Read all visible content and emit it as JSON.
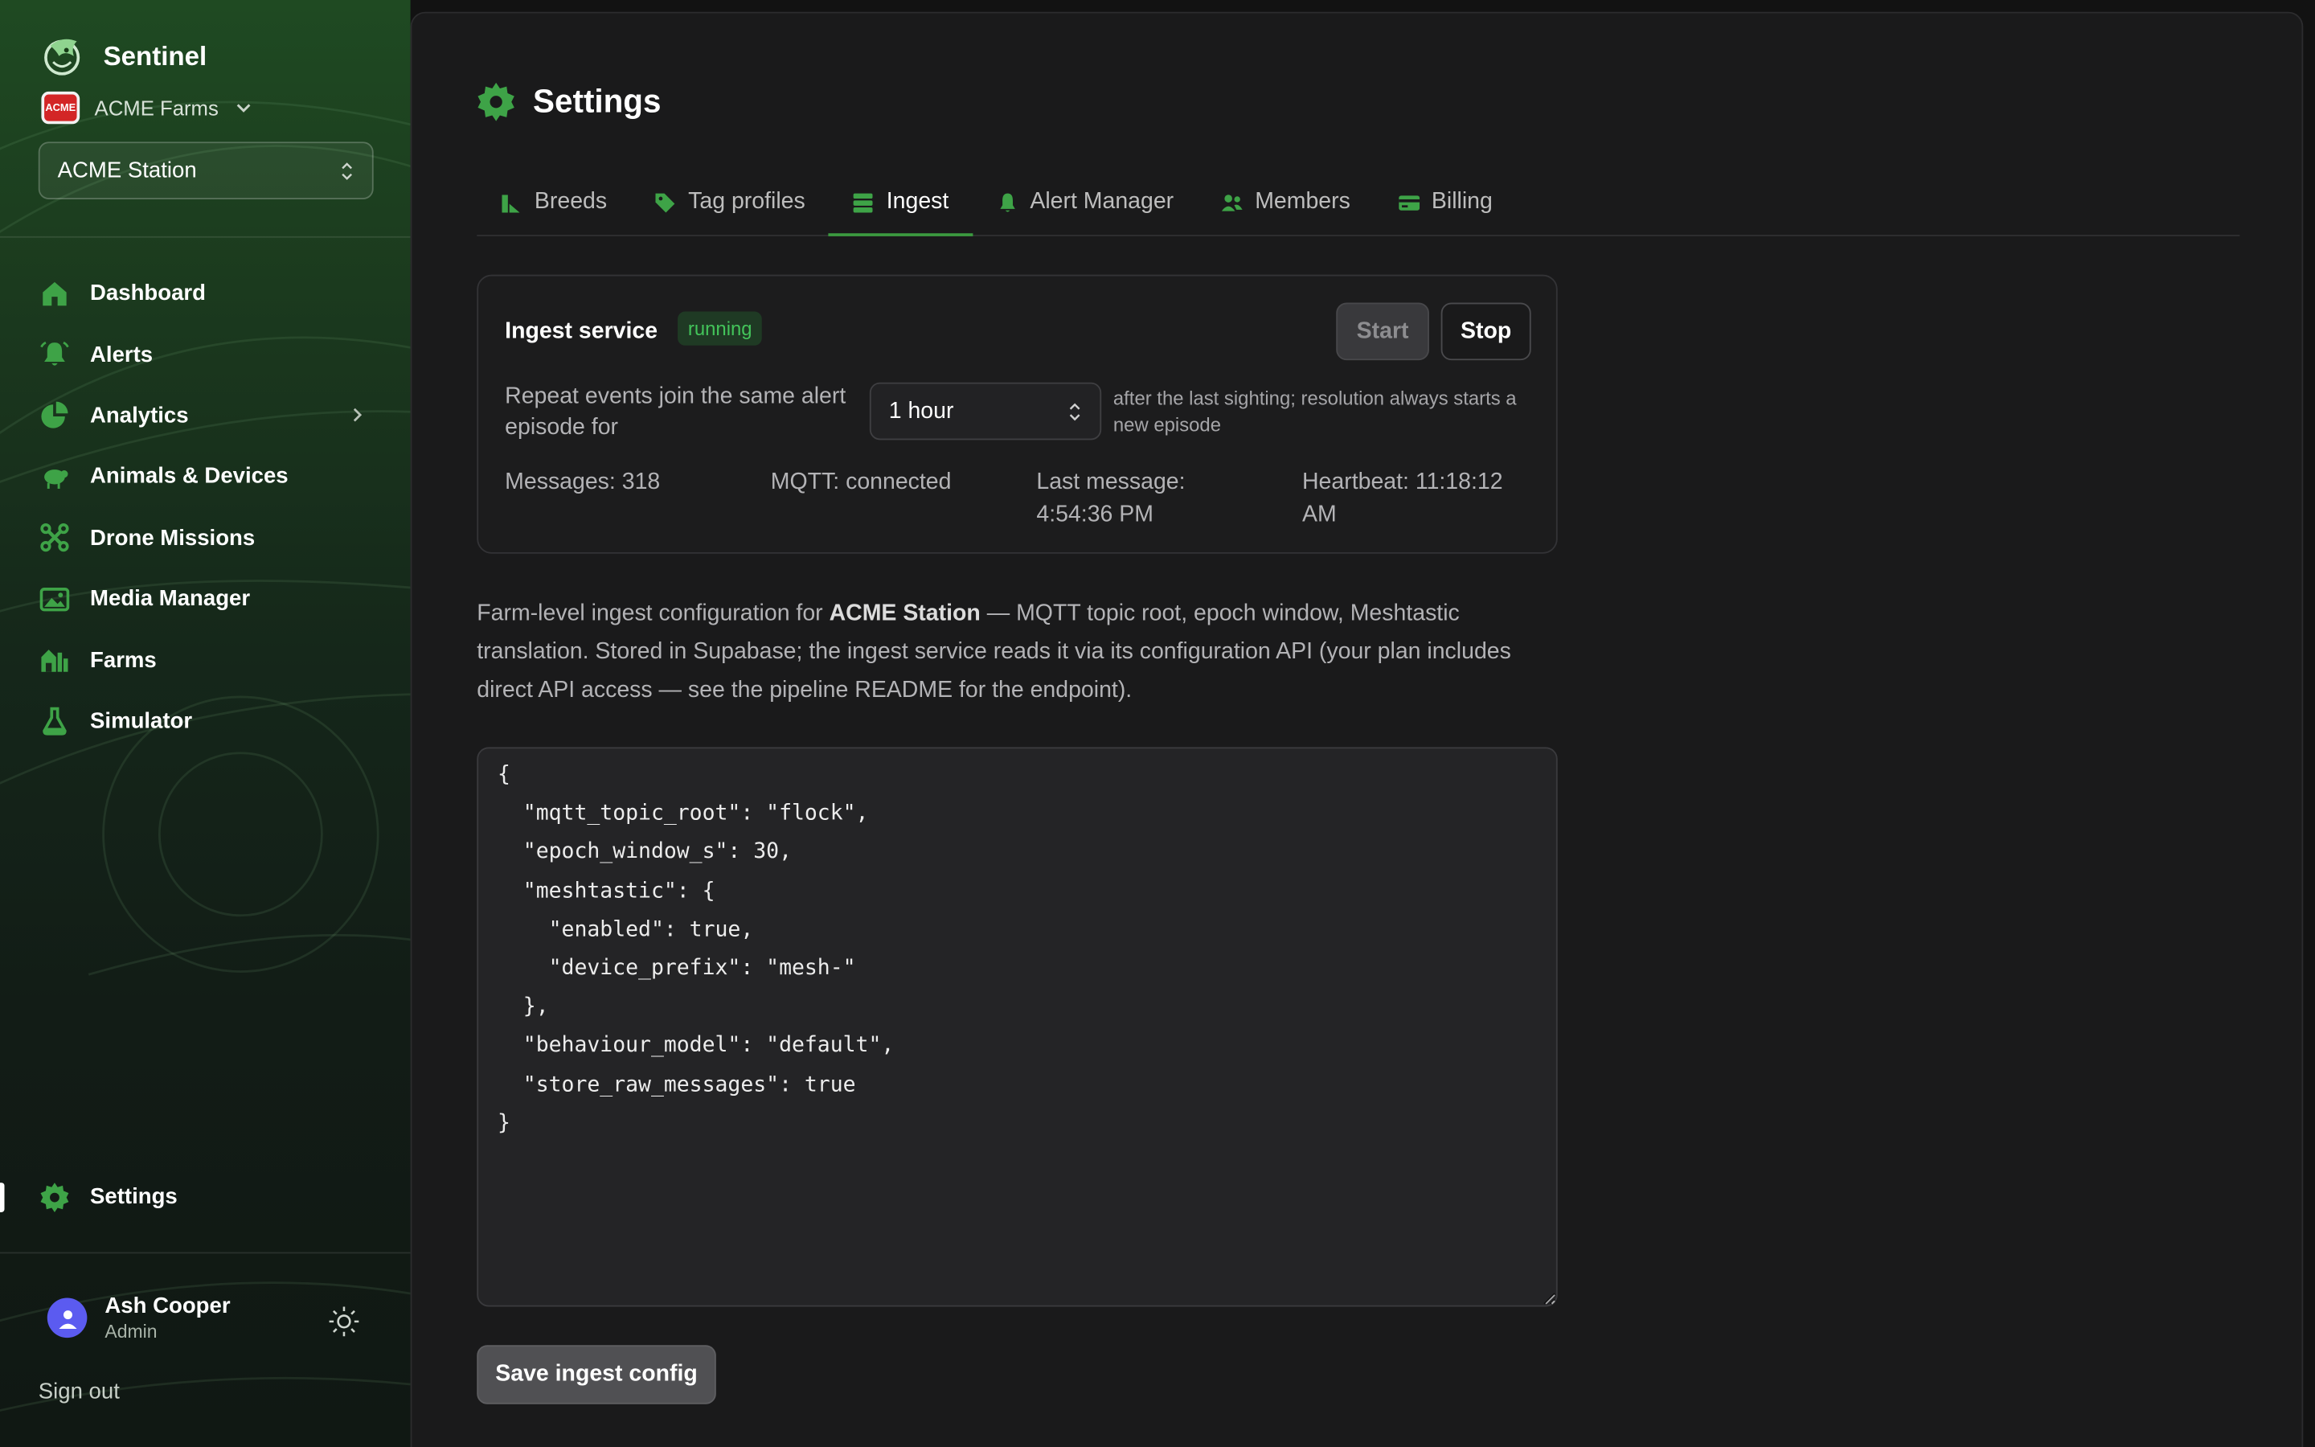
{
  "brand": {
    "name": "Sentinel"
  },
  "org": {
    "name": "ACME Farms",
    "logo_text": "ACME"
  },
  "station": {
    "selected": "ACME Station"
  },
  "nav": {
    "items": [
      {
        "label": "Dashboard",
        "icon": "home-icon"
      },
      {
        "label": "Alerts",
        "icon": "bell-icon"
      },
      {
        "label": "Analytics",
        "icon": "pie-chart-icon"
      },
      {
        "label": "Animals & Devices",
        "icon": "sheep-icon"
      },
      {
        "label": "Drone Missions",
        "icon": "drone-icon"
      },
      {
        "label": "Media Manager",
        "icon": "image-icon"
      },
      {
        "label": "Farms",
        "icon": "barn-icon"
      },
      {
        "label": "Simulator",
        "icon": "flask-icon"
      }
    ],
    "settings_label": "Settings"
  },
  "user": {
    "name": "Ash Cooper",
    "role": "Admin"
  },
  "signout_label": "Sign out",
  "page": {
    "title": "Settings"
  },
  "tabs": [
    {
      "label": "Breeds",
      "icon": "breeds-icon"
    },
    {
      "label": "Tag profiles",
      "icon": "tag-icon"
    },
    {
      "label": "Ingest",
      "icon": "server-icon",
      "active": true
    },
    {
      "label": "Alert Manager",
      "icon": "bell-icon"
    },
    {
      "label": "Members",
      "icon": "users-icon"
    },
    {
      "label": "Billing",
      "icon": "credit-card-icon"
    }
  ],
  "ingest": {
    "service_title": "Ingest service",
    "status": "running",
    "start_label": "Start",
    "stop_label": "Stop",
    "repeat_label": "Repeat events join the same alert episode for",
    "episode_window": "1 hour",
    "after_text": "after the last sighting; resolution always starts a new episode",
    "stats": {
      "messages": "Messages: 318",
      "mqtt": "MQTT: connected",
      "last_message": "Last message: 4:54:36 PM",
      "heartbeat": "Heartbeat: 11:18:12 AM"
    },
    "description_prefix": "Farm-level ingest configuration for ",
    "description_station": "ACME Station",
    "description_suffix": " — MQTT topic root, epoch window, Meshtastic translation. Stored in Supabase; the ingest service reads it via its configuration API (your plan includes direct API access — see the pipeline README for the endpoint).",
    "config_json": "{\n  \"mqtt_topic_root\": \"flock\",\n  \"epoch_window_s\": 30,\n  \"meshtastic\": {\n    \"enabled\": true,\n    \"device_prefix\": \"mesh-\"\n  },\n  \"behaviour_model\": \"default\",\n  \"store_raw_messages\": true\n}",
    "save_label": "Save ingest config"
  },
  "colors": {
    "accent_green": "#3b9a3f",
    "status_green": "#43c45a",
    "sidebar_top": "#1f4a22",
    "main_bg": "#1a1a1b"
  }
}
